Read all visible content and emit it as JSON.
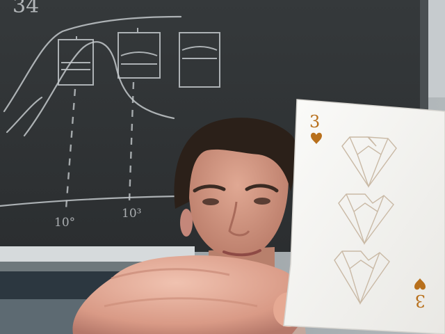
{
  "scene": {
    "description_colors": {
      "chalkboard": "#2f3336",
      "chalk": "#c9cdd0",
      "wall": "#9fa6aa",
      "skin": "#d79b86",
      "hair": "#2b2019",
      "card": "#f4f3f0",
      "card_pip": "#b8701c"
    }
  },
  "chalkboard": {
    "corner_number": "34",
    "axis_label_left": "10°",
    "axis_label_right": "10³"
  },
  "card": {
    "rank": "3",
    "suit_icon": "heart-icon",
    "pip_count": 3
  }
}
